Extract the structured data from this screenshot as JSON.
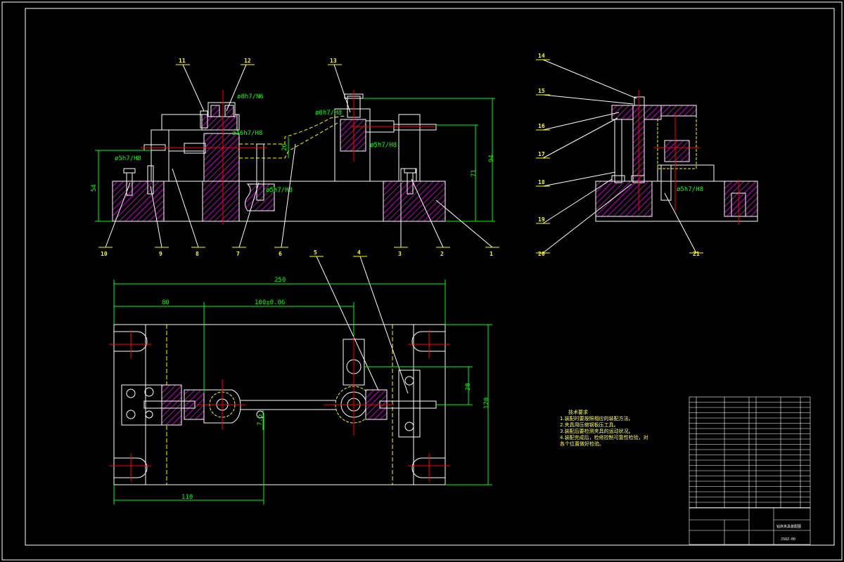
{
  "colors": {
    "background": "#000000",
    "outline": "#ffffff",
    "section": "#ff00ff",
    "dimension": "#00ff00",
    "centerline": "#ff0000",
    "callout": "#ffff00",
    "hidden": "#ffff00"
  },
  "front_view": {
    "callouts": [
      "11",
      "12",
      "13",
      "10",
      "9",
      "8",
      "7",
      "6",
      "5",
      "4",
      "3",
      "2",
      "1"
    ],
    "fits": [
      "ø8h7/N6",
      "ø16h7/H8",
      "ø5h7/H8",
      "ø5h7/H8",
      "ø8h7/H8",
      "ø5h7/H8"
    ],
    "dimensions": [
      "54",
      "20",
      "71",
      "94"
    ]
  },
  "side_view": {
    "callouts": [
      "14",
      "15",
      "16",
      "17",
      "18",
      "19",
      "20",
      "21"
    ],
    "fits": [
      "ø5h7/H8"
    ]
  },
  "top_view": {
    "dimensions": [
      "250",
      "80",
      "100±0.06",
      "28",
      "120",
      "7.5",
      "110"
    ]
  },
  "tech_notes": {
    "title": "技术要求",
    "lines": [
      "1.装配时要按照相应的装配方法。",
      "2.夹具用压缩钢板压工具。",
      "3.装配后要检测夹具的运动状况。",
      "4.装配完成后，检修控制可靠性检验，对",
      "  各个位置做好检验。"
    ]
  },
  "title_block": {
    "drawing_no": "JSQZ-00",
    "name": "钻床夹具装配图"
  }
}
